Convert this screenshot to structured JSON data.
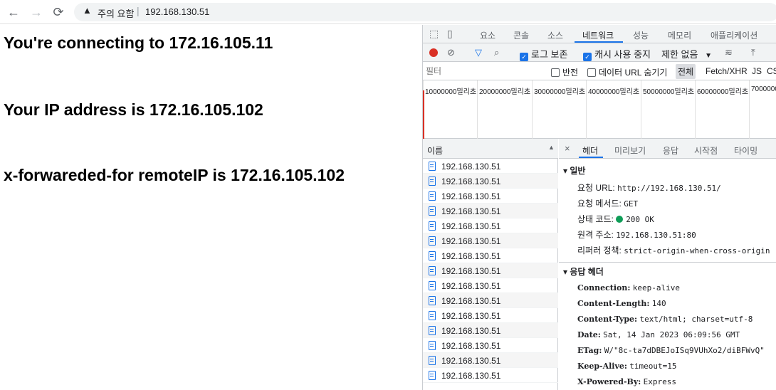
{
  "browser": {
    "security_label": "주의 요함",
    "url": "192.168.130.51"
  },
  "page": {
    "line1": "You're connecting to 172.16.105.11",
    "line2": "Your IP address is 172.16.105.102",
    "line3": "x-forwareded-for remoteIP is 172.16.105.102"
  },
  "devtools": {
    "tabs": [
      "요소",
      "콘솔",
      "소스",
      "네트워크",
      "성능",
      "메모리",
      "애플리케이션"
    ],
    "active_tab": "네트워크",
    "toolbar": {
      "preserve_log": "로그 보존",
      "disable_cache": "캐시 사용 중지",
      "throttle": "제한 없음"
    },
    "filter": {
      "placeholder": "필터",
      "invert": "반전",
      "hide_data_urls": "데이터 URL 숨기기",
      "all": "전체",
      "fetch_xhr": "Fetch/XHR",
      "js": "JS",
      "css": "CS"
    },
    "overview_ticks": [
      "10000000밀리초",
      "20000000밀리초",
      "30000000밀리초",
      "40000000밀리초",
      "50000000밀리초",
      "60000000밀리초",
      "7000000"
    ],
    "name_header": "이름",
    "requests": [
      "192.168.130.51",
      "192.168.130.51",
      "192.168.130.51",
      "192.168.130.51",
      "192.168.130.51",
      "192.168.130.51",
      "192.168.130.51",
      "192.168.130.51",
      "192.168.130.51",
      "192.168.130.51",
      "192.168.130.51",
      "192.168.130.51",
      "192.168.130.51",
      "192.168.130.51",
      "192.168.130.51"
    ],
    "detail_tabs": [
      "헤더",
      "미리보기",
      "응답",
      "시작점",
      "타이밍"
    ],
    "close": "×",
    "general": {
      "title": "▾ 일반",
      "rows": [
        {
          "key": "요청 URL:",
          "value": "http://192.168.130.51/"
        },
        {
          "key": "요청 메서드:",
          "value": "GET"
        },
        {
          "key": "상태 코드:",
          "value": "200 OK"
        },
        {
          "key": "원격 주소:",
          "value": "192.168.130.51:80"
        },
        {
          "key": "리퍼러 정책:",
          "value": "strict-origin-when-cross-origin"
        }
      ]
    },
    "response_headers": {
      "title": "▾ 응답 헤더",
      "rows": [
        {
          "key": "Connection:",
          "value": "keep-alive"
        },
        {
          "key": "Content-Length:",
          "value": "140"
        },
        {
          "key": "Content-Type:",
          "value": "text/html; charset=utf-8"
        },
        {
          "key": "Date:",
          "value": "Sat, 14 Jan 2023 06:09:56 GMT"
        },
        {
          "key": "ETag:",
          "value": "W/\"8c-ta7dDBEJoISq9VUhXo2/diBFWvQ\""
        },
        {
          "key": "Keep-Alive:",
          "value": "timeout=15"
        },
        {
          "key": "X-Powered-By:",
          "value": "Express"
        }
      ]
    }
  }
}
